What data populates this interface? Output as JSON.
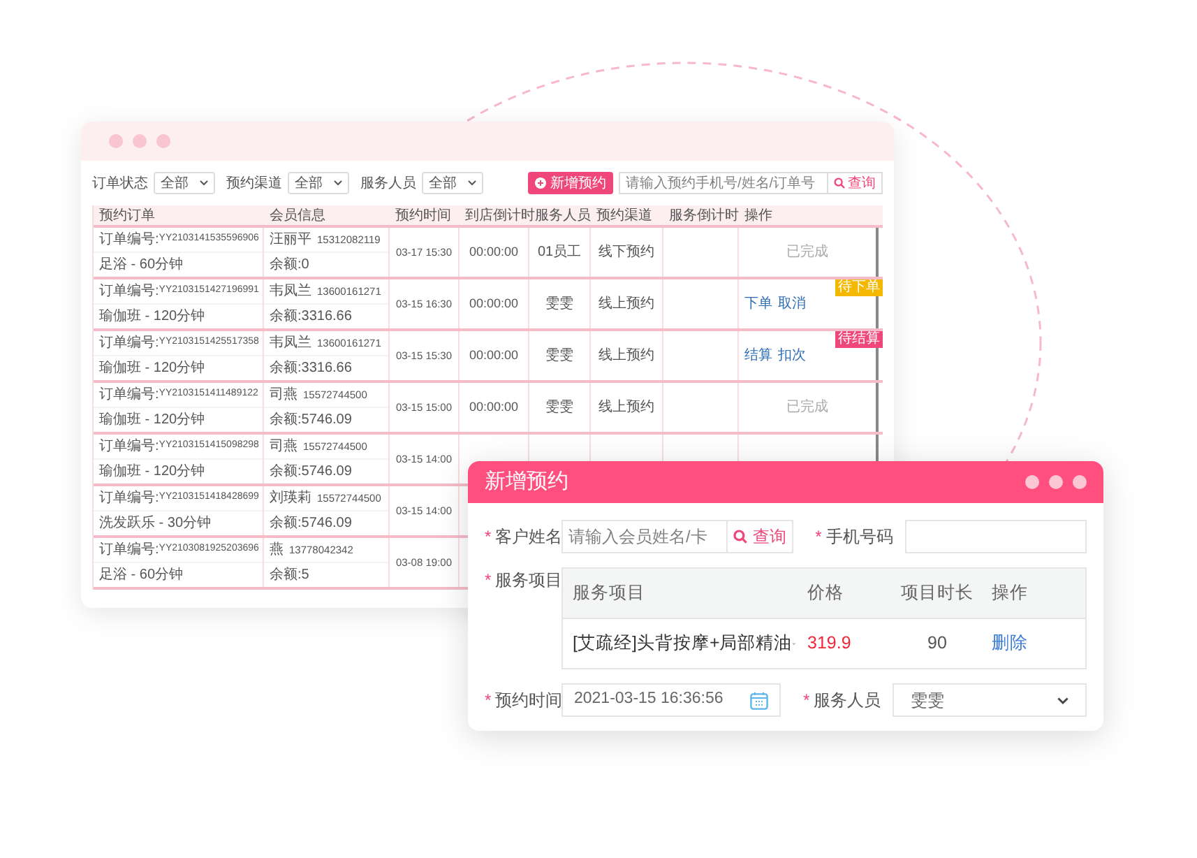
{
  "list_window": {
    "filters": [
      {
        "label": "订单状态",
        "value": "全部"
      },
      {
        "label": "预约渠道",
        "value": "全部"
      },
      {
        "label": "服务人员",
        "value": "全部"
      }
    ],
    "add_button": "新增预约",
    "search": {
      "placeholder": "请输入预约手机号/姓名/订单号",
      "button": "查询"
    },
    "table": {
      "columns": [
        "预约订单",
        "会员信息",
        "预约时间",
        "到店倒计时",
        "服务人员",
        "预约渠道",
        "服务倒计时",
        "操作"
      ],
      "rows": [
        {
          "order_label": "订单编号:",
          "order_no": "YY2103141535596906",
          "service": "足浴 - 60分钟",
          "member": "汪丽平",
          "phone": "15312082119",
          "balance": "余额:0",
          "time": "03-17 15:30",
          "countdown": "00:00:00",
          "staff": "01员工",
          "channel": "线下预约",
          "kind": "done",
          "status": "已完成"
        },
        {
          "order_label": "订单编号:",
          "order_no": "YY2103151427196991",
          "service": "瑜伽班 - 120分钟",
          "member": "韦凤兰",
          "phone": "13600161271",
          "balance": "余额:3316.66",
          "time": "03-15 16:30",
          "countdown": "00:00:00",
          "staff": "雯雯",
          "channel": "线上预约",
          "kind": "actions",
          "actions": [
            "下单",
            "取消"
          ],
          "tag": {
            "text": "待下单",
            "color": "#f5b800"
          }
        },
        {
          "order_label": "订单编号:",
          "order_no": "YY2103151425517358",
          "service": "瑜伽班 - 120分钟",
          "member": "韦凤兰",
          "phone": "13600161271",
          "balance": "余额:3316.66",
          "time": "03-15 15:30",
          "countdown": "00:00:00",
          "staff": "雯雯",
          "channel": "线上预约",
          "kind": "actions",
          "actions": [
            "结算",
            "扣次"
          ],
          "tag": {
            "text": "待结算",
            "color": "#f0477a"
          }
        },
        {
          "order_label": "订单编号:",
          "order_no": "YY2103151411489122",
          "service": "瑜伽班 - 120分钟",
          "member": "司燕",
          "phone": "15572744500",
          "balance": "余额:5746.09",
          "time": "03-15 15:00",
          "countdown": "00:00:00",
          "staff": "雯雯",
          "channel": "线上预约",
          "kind": "done",
          "status": "已完成"
        },
        {
          "order_label": "订单编号:",
          "order_no": "YY2103151415098298",
          "service": "瑜伽班 - 120分钟",
          "member": "司燕",
          "phone": "15572744500",
          "balance": "余额:5746.09",
          "time": "03-15 14:00"
        },
        {
          "order_label": "订单编号:",
          "order_no": "YY2103151418428699",
          "service": "洗发跃乐 - 30分钟",
          "member": "刘瑛莉",
          "phone": "15572744500",
          "balance": "余额:5746.09",
          "time": "03-15 14:00"
        },
        {
          "order_label": "订单编号:",
          "order_no": "YY2103081925203696",
          "service": "足浴 - 60分钟",
          "member": "燕",
          "phone": "13778042342",
          "balance": "余额:5",
          "time": "03-08 19:00"
        }
      ]
    }
  },
  "dialog": {
    "title": "新增预约",
    "customer": {
      "required_mark": "*",
      "label": "客户姓名",
      "placeholder": "请输入会员姓名/卡",
      "button": "查询"
    },
    "phone": {
      "required_mark": "*",
      "label": "手机号码"
    },
    "services": {
      "required_mark": "*",
      "label": "服务项目",
      "columns": [
        "服务项目",
        "价格",
        "项目时长",
        "操作"
      ],
      "rows": [
        {
          "name": "[艾疏经]头背按摩+局部精油",
          "price": "319.9",
          "duration": "90",
          "action": "删除"
        }
      ]
    },
    "time": {
      "required_mark": "*",
      "label": "预约时间",
      "value": "2021-03-15 16:36:56"
    },
    "staff": {
      "required_mark": "*",
      "label": "服务人员",
      "value": "雯雯"
    }
  }
}
